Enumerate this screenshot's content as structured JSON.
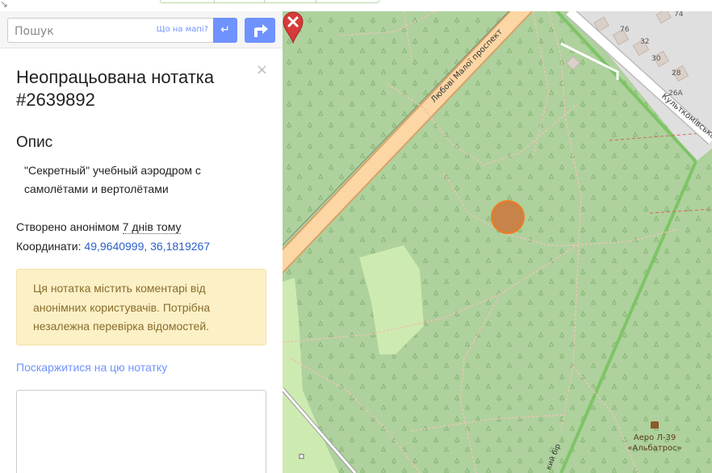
{
  "search": {
    "placeholder": "Пошук",
    "where_link": "Що на мапі?",
    "go_glyph": "↵"
  },
  "note": {
    "title": "Неопрацьована нотатка #2639892",
    "description_heading": "Опис",
    "description": "\"Секретный\" учебный аэродром с самолётами и вертолётами",
    "created_prefix": "Створено анонімом ",
    "created_ago": "7 днів тому",
    "coords_prefix": "Координати: ",
    "coords": "49,9640999, 36,1819267",
    "warning": "Ця нотатка містить коментарі від анонімних користувачів. Потрібна незалежна перевірка відомостей.",
    "report_link": "Поскаржитися на цю нотатку",
    "close_glyph": "×"
  },
  "map": {
    "road_main": "Любові Малої проспект",
    "road_right": "Культкомівська",
    "road_bottom": "кий бір",
    "house_numbers": [
      "74",
      "76",
      "32",
      "30",
      "28",
      "26А"
    ],
    "poi": "Аеро Л-39 «Альбатрос»",
    "colors": {
      "forest": "#aed19e",
      "meadow": "#cdebb0",
      "main_road": "#fcd6a4",
      "note_marker": "#d63a3a",
      "note_circle": "#c8834a",
      "accent": "#7092ff"
    }
  }
}
